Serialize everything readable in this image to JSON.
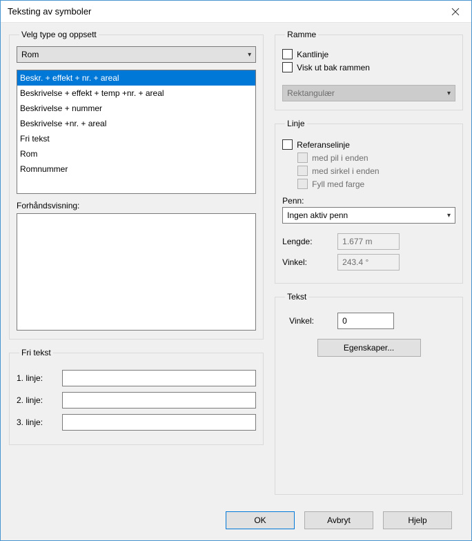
{
  "window": {
    "title": "Teksting av symboler"
  },
  "left": {
    "group_label": "Velg type og oppsett",
    "type_selected": "Rom",
    "list_items": [
      "Beskr. + effekt + nr. + areal",
      "Beskrivelse + effekt + temp +nr. + areal",
      "Beskrivelse + nummer",
      "Beskrivelse +nr. + areal",
      "Fri tekst",
      "Rom",
      "Romnummer"
    ],
    "preview_label": "Forhåndsvisning:"
  },
  "fritext": {
    "group_label": "Fri tekst",
    "line1_label": "1. linje:",
    "line2_label": "2. linje:",
    "line3_label": "3. linje:",
    "line1_value": "",
    "line2_value": "",
    "line3_value": ""
  },
  "ramme": {
    "group_label": "Ramme",
    "kantlinje": "Kantlinje",
    "viskut": "Visk ut bak rammen",
    "shape": "Rektangulær"
  },
  "linje": {
    "group_label": "Linje",
    "ref": "Referanselinje",
    "pil": "med pil i enden",
    "sirkel": "med sirkel i enden",
    "fyll": "Fyll med farge",
    "penn_label": "Penn:",
    "penn_value": "Ingen aktiv penn",
    "lengde_label": "Lengde:",
    "lengde_value": "1.677 m",
    "vinkel_label": "Vinkel:",
    "vinkel_value": "243.4 °"
  },
  "tekst": {
    "group_label": "Tekst",
    "vinkel_label": "Vinkel:",
    "vinkel_value": "0",
    "egenskaper": "Egenskaper..."
  },
  "footer": {
    "ok": "OK",
    "cancel": "Avbryt",
    "help": "Hjelp"
  }
}
